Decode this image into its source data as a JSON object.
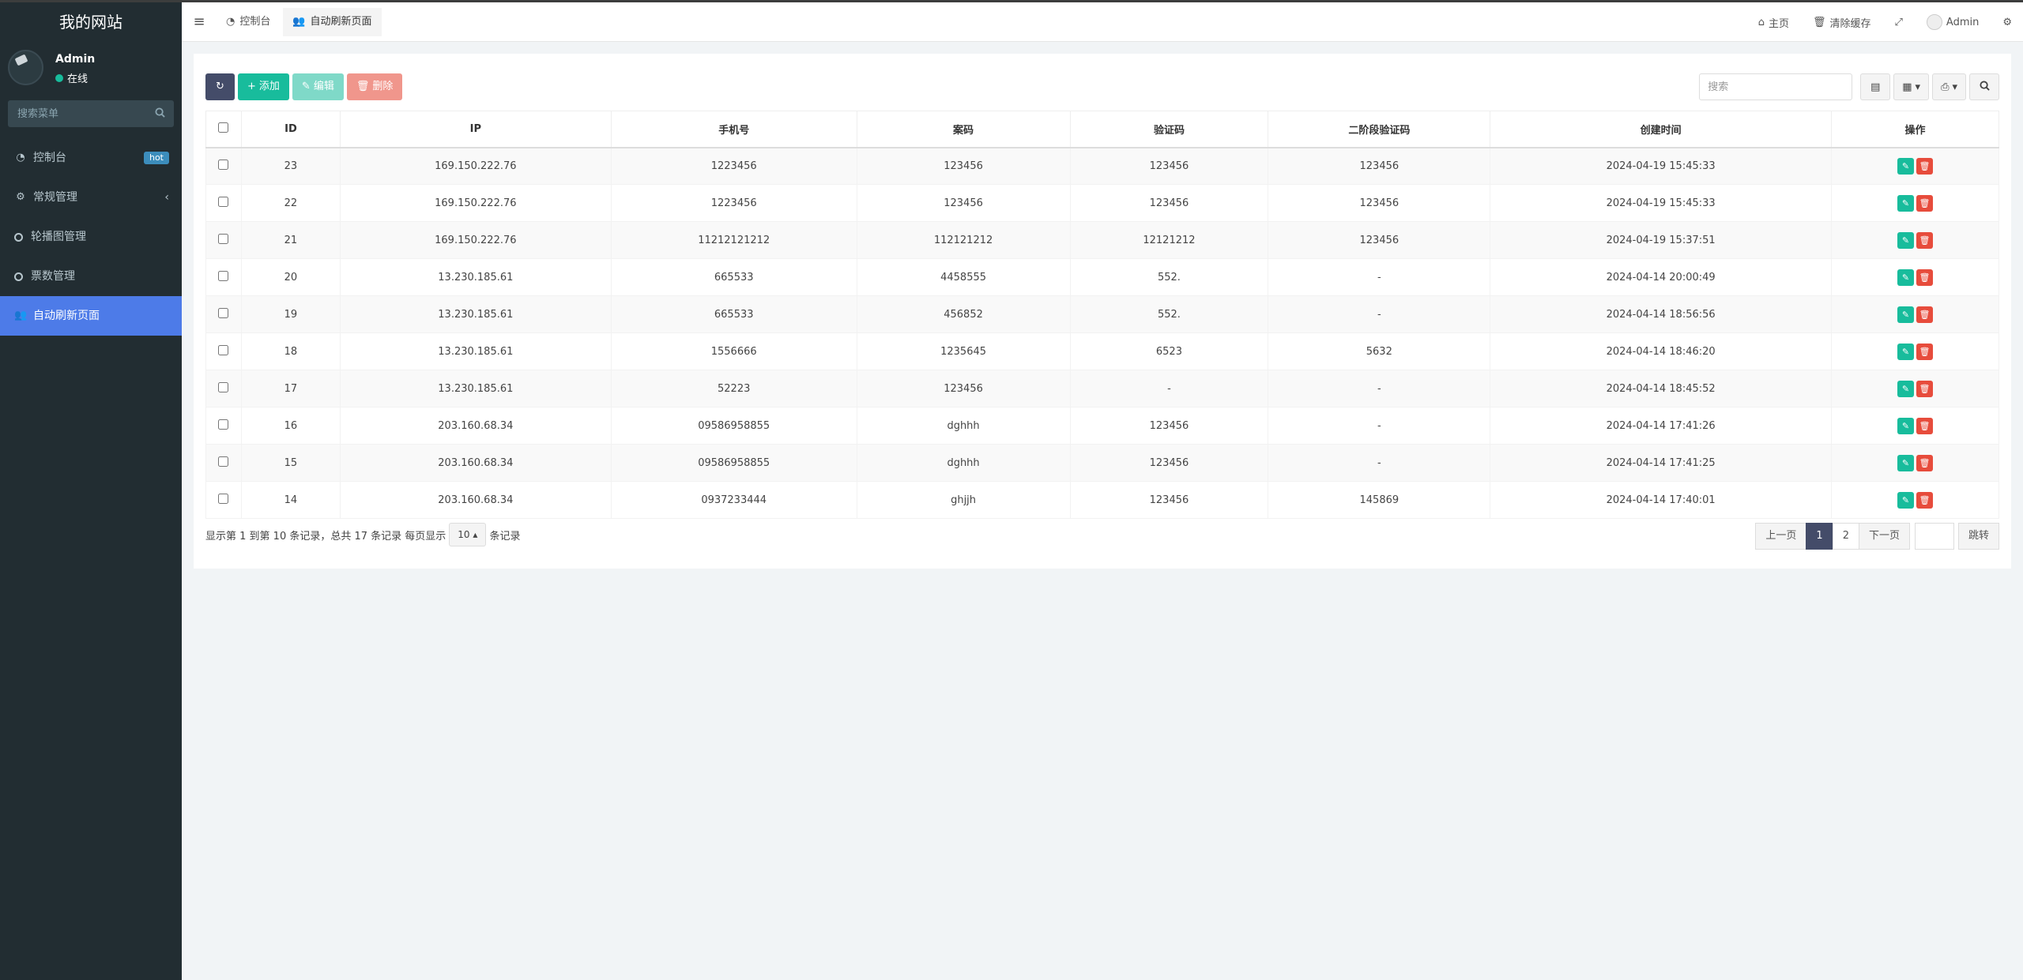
{
  "site": {
    "title": "我的网站"
  },
  "user": {
    "name": "Admin",
    "status": "在线"
  },
  "sidebar": {
    "search_placeholder": "搜索菜单",
    "items": [
      {
        "label": "控制台",
        "badge": "hot"
      },
      {
        "label": "常规管理"
      },
      {
        "label": "轮播图管理"
      },
      {
        "label": "票数管理"
      },
      {
        "label": "自动刷新页面"
      }
    ]
  },
  "header": {
    "tabs": [
      {
        "label": "控制台"
      },
      {
        "label": "自动刷新页面"
      }
    ],
    "home": "主页",
    "clear_cache": "清除缓存",
    "admin": "Admin"
  },
  "toolbar": {
    "add": "添加",
    "edit": "编辑",
    "delete": "删除",
    "search_placeholder": "搜索"
  },
  "table": {
    "columns": [
      "ID",
      "IP",
      "手机号",
      "案码",
      "验证码",
      "二阶段验证码",
      "创建时间",
      "操作"
    ],
    "rows": [
      [
        "23",
        "169.150.222.76",
        "1223456",
        "123456",
        "123456",
        "123456",
        "2024-04-19 15:45:33"
      ],
      [
        "22",
        "169.150.222.76",
        "1223456",
        "123456",
        "123456",
        "123456",
        "2024-04-19 15:45:33"
      ],
      [
        "21",
        "169.150.222.76",
        "11212121212",
        "112121212",
        "12121212",
        "123456",
        "2024-04-19 15:37:51"
      ],
      [
        "20",
        "13.230.185.61",
        "665533",
        "4458555",
        "552.",
        "-",
        "2024-04-14 20:00:49"
      ],
      [
        "19",
        "13.230.185.61",
        "665533",
        "456852",
        "552.",
        "-",
        "2024-04-14 18:56:56"
      ],
      [
        "18",
        "13.230.185.61",
        "1556666",
        "1235645",
        "6523",
        "5632",
        "2024-04-14 18:46:20"
      ],
      [
        "17",
        "13.230.185.61",
        "52223",
        "123456",
        "-",
        "-",
        "2024-04-14 18:45:52"
      ],
      [
        "16",
        "203.160.68.34",
        "09586958855",
        "dghhh",
        "123456",
        "-",
        "2024-04-14 17:41:26"
      ],
      [
        "15",
        "203.160.68.34",
        "09586958855",
        "dghhh",
        "123456",
        "-",
        "2024-04-14 17:41:25"
      ],
      [
        "14",
        "203.160.68.34",
        "0937233444",
        "ghjjh",
        "123456",
        "145869",
        "2024-04-14 17:40:01"
      ]
    ]
  },
  "footer": {
    "info": "显示第 1 到第 10 条记录，总共 17 条记录 每页显示",
    "page_size": "10",
    "suffix": "条记录",
    "prev": "上一页",
    "pages": [
      "1",
      "2"
    ],
    "next": "下一页",
    "jump": "跳转"
  },
  "colors": {
    "sidebar_bg": "#222d32",
    "active_menu": "#4d7be8",
    "success": "#18bc9c",
    "danger": "#e74c3c",
    "primary_dark": "#444c69"
  }
}
